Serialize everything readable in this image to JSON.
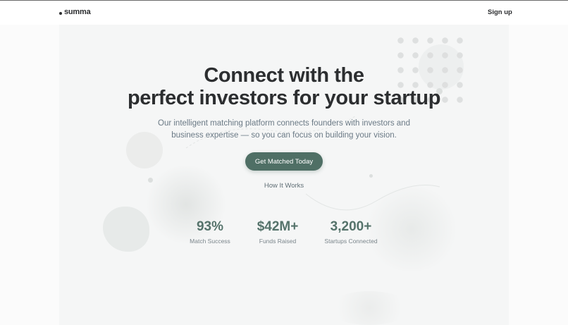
{
  "header": {
    "logo_text": "summa",
    "signup_label": "Sign up"
  },
  "hero": {
    "headline_line1": "Connect with the",
    "headline_line2": "perfect investors for your startup",
    "subtext": "Our intelligent matching platform connects founders with investors and business expertise — so you can focus on building your vision.",
    "cta_label": "Get Matched Today",
    "secondary_link": "How It Works"
  },
  "stats": [
    {
      "value": "93%",
      "label": "Match Success"
    },
    {
      "value": "$42M+",
      "label": "Funds Raised"
    },
    {
      "value": "3,200+",
      "label": "Startups Connected"
    }
  ],
  "colors": {
    "accent": "#4f6f65",
    "stat_value": "#55736b",
    "background": "#f5f6f6"
  }
}
